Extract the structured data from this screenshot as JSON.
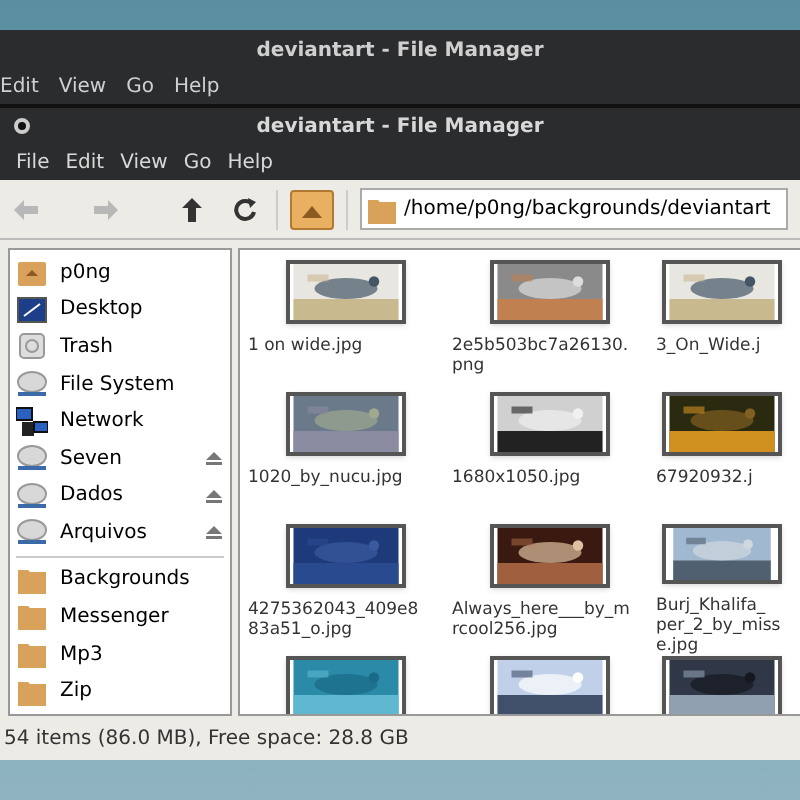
{
  "back_window": {
    "title": "deviantart - File Manager",
    "menu": [
      "Edit",
      "View",
      "Go",
      "Help"
    ]
  },
  "window": {
    "title": "deviantart - File Manager"
  },
  "menu": [
    "File",
    "Edit",
    "View",
    "Go",
    "Help"
  ],
  "toolbar": {
    "back_disabled": true,
    "forward_disabled": true,
    "home_selected": true,
    "path": "/home/p0ng/backgrounds/deviantart"
  },
  "sidebar": {
    "places": [
      {
        "label": "p0ng",
        "kind": "home",
        "ejectable": false
      },
      {
        "label": "Desktop",
        "kind": "desktop",
        "ejectable": false
      },
      {
        "label": "Trash",
        "kind": "trash",
        "ejectable": false
      },
      {
        "label": "File System",
        "kind": "drive",
        "ejectable": false
      },
      {
        "label": "Network",
        "kind": "network",
        "ejectable": false
      },
      {
        "label": "Seven",
        "kind": "drive",
        "ejectable": true
      },
      {
        "label": "Dados",
        "kind": "drive",
        "ejectable": true
      },
      {
        "label": "Arquivos",
        "kind": "drive",
        "ejectable": true
      }
    ],
    "bookmarks": [
      {
        "label": "Backgrounds",
        "kind": "folder"
      },
      {
        "label": "Messenger",
        "kind": "folder"
      },
      {
        "label": "Mp3",
        "kind": "folder"
      },
      {
        "label": "Zip",
        "kind": "folder"
      }
    ]
  },
  "files": [
    {
      "kind": "picture",
      "label_lines": [
        "1 on wide.jpg"
      ]
    },
    {
      "kind": "picture",
      "label_lines": [
        "2e5b503bc7a26130.",
        "png"
      ]
    },
    {
      "kind": "picture",
      "label_lines": [
        "3_On_Wide.j"
      ]
    },
    {
      "kind": "picture",
      "label_lines": [
        "1020_by_nucu.jpg"
      ]
    },
    {
      "kind": "picture",
      "label_lines": [
        "1680x1050.jpg"
      ]
    },
    {
      "kind": "picture",
      "label_lines": [
        "67920932.j"
      ]
    },
    {
      "kind": "picture",
      "label_lines": [
        "4275362043_409e8",
        "83a51_o.jpg"
      ]
    },
    {
      "kind": "picture",
      "label_lines": [
        "Always_here___by_m",
        "rcool256.jpg"
      ]
    },
    {
      "kind": "picture",
      "label_lines": [
        "Burj_Khalifa_",
        "per_2_by_miss",
        "e.jpg"
      ]
    },
    {
      "kind": "picture"
    },
    {
      "kind": "picture"
    },
    {
      "kind": "picture"
    }
  ],
  "status_bar": "54 items (86.0 MB), Free space: 28.8 GB"
}
